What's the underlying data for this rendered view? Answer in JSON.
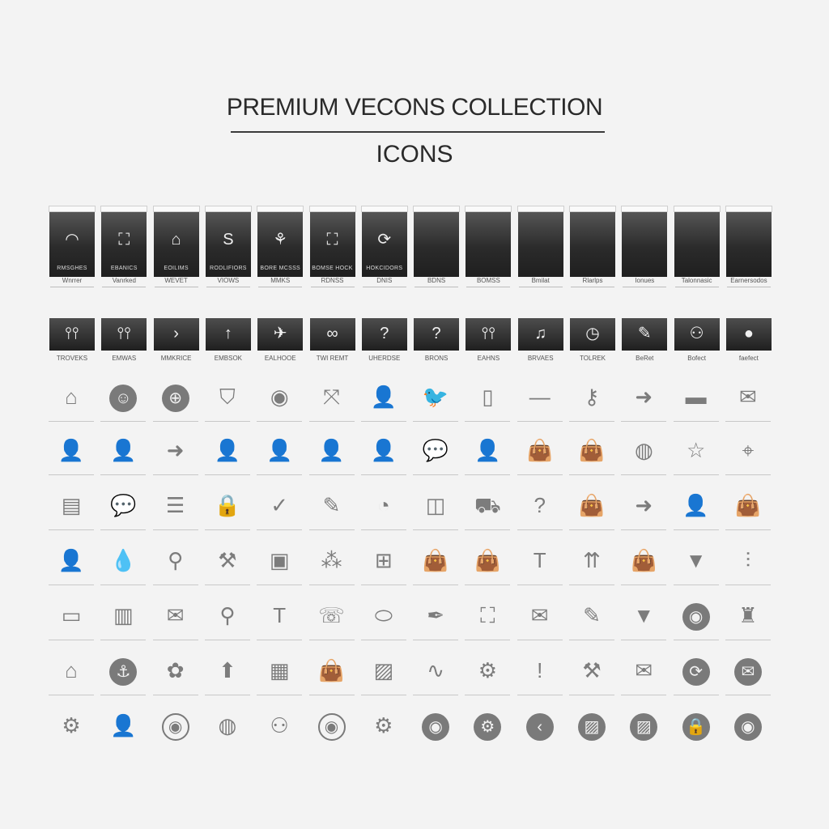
{
  "header": {
    "title": "PREMIUM VECONS COLLECTION",
    "subtitle": "ICONS"
  },
  "row1": [
    {
      "glyph": "wifi-icon",
      "char": "◠",
      "name": "RMSGHES",
      "caption": "Wnrrer"
    },
    {
      "glyph": "bag-icon",
      "char": "⛶",
      "name": "EBANICS",
      "caption": "Vanrked"
    },
    {
      "glyph": "bag-icon",
      "char": "⌂",
      "name": "EOILIMS",
      "caption": "WEVET"
    },
    {
      "glyph": "s-icon",
      "char": "S",
      "name": "RODLIFIORS",
      "caption": "VIOWS"
    },
    {
      "glyph": "leaf-icon",
      "char": "⚘",
      "name": "BORE MCSSS",
      "caption": "MMKS"
    },
    {
      "glyph": "bag-icon",
      "char": "⛶",
      "name": "BOMSE HOCK",
      "caption": "RDNSS"
    },
    {
      "glyph": "refresh-icon",
      "char": "⟳",
      "name": "HOKCIDORS",
      "caption": "DNIS"
    },
    {
      "glyph": "blank",
      "char": "",
      "name": "",
      "caption": "BDNS"
    },
    {
      "glyph": "blank",
      "char": "",
      "name": "",
      "caption": "BOMSS"
    },
    {
      "glyph": "blank",
      "char": "",
      "name": "",
      "caption": "Bmilat"
    },
    {
      "glyph": "blank",
      "char": "",
      "name": "",
      "caption": "Rlarlps"
    },
    {
      "glyph": "blank",
      "char": "",
      "name": "",
      "caption": "Ionues"
    },
    {
      "glyph": "blank",
      "char": "",
      "name": "",
      "caption": "Talonnasic"
    },
    {
      "glyph": "blank",
      "char": "",
      "name": "",
      "caption": "Earnersodos"
    }
  ],
  "row2": [
    {
      "glyph": "equalizer-icon",
      "char": "⫯⫯",
      "caption": "TROVEKS"
    },
    {
      "glyph": "equalizer-icon",
      "char": "⫯⫯",
      "caption": "EMWAS"
    },
    {
      "glyph": "chevron-right-icon",
      "char": "›",
      "caption": "MMKRICE"
    },
    {
      "glyph": "arrow-up-icon",
      "char": "↑",
      "caption": "EMBSOK"
    },
    {
      "glyph": "plane-icon",
      "char": "✈",
      "caption": "EALHOOE"
    },
    {
      "glyph": "infinity-icon",
      "char": "∞",
      "caption": "TWI REMT"
    },
    {
      "glyph": "question-icon",
      "char": "?",
      "caption": "UHERDSE"
    },
    {
      "glyph": "question-icon",
      "char": "?",
      "caption": "BRONS"
    },
    {
      "glyph": "equalizer-icon",
      "char": "⫯⫯",
      "caption": "EAHNS"
    },
    {
      "glyph": "music-icon",
      "char": "♫",
      "caption": "BRVAES"
    },
    {
      "glyph": "clock-icon",
      "char": "◷",
      "caption": "TOLREK"
    },
    {
      "glyph": "edit-icon",
      "char": "✎",
      "caption": "BeRet"
    },
    {
      "glyph": "users-icon",
      "char": "⚇",
      "caption": "Bofect"
    },
    {
      "glyph": "user-icon",
      "char": "●",
      "caption": "faefect"
    }
  ],
  "icon_rows": [
    [
      "home-icon",
      "add-user-icon",
      "plus-circle-icon",
      "shield-icon",
      "fingerprint-icon",
      "share-icon",
      "user-icon",
      "twitter-icon",
      "mobile-icon",
      "minus-icon",
      "key-icon",
      "arrow-right-icon",
      "rectangle-icon",
      "mail-icon"
    ],
    [
      "user-icon",
      "user-icon",
      "arrow-right-icon",
      "user-icon",
      "user-icon",
      "user-icon",
      "user-icon",
      "chat-icon",
      "user-icon",
      "bag-icon",
      "bag-icon",
      "globe-icon",
      "star-icon",
      "location-icon"
    ],
    [
      "card-icon",
      "chat-icon",
      "list-icon",
      "lock-user-icon",
      "check-icon",
      "pencil-icon",
      "compass-icon",
      "camera-icon",
      "truck-icon",
      "question-icon",
      "bag-icon",
      "arrow-right-icon",
      "user-icon",
      "bag-icon"
    ],
    [
      "user-icon",
      "drop-icon",
      "pin-icon",
      "tools-icon",
      "device-icon",
      "network-icon",
      "grid-icon",
      "bag-icon",
      "bag-icon",
      "hammer-icon",
      "arrows-up-icon",
      "bag-icon",
      "triangle-down-icon",
      "sliders-icon"
    ],
    [
      "tablet-icon",
      "chart-icon",
      "mail-icon",
      "pin-clip-icon",
      "hammer-icon",
      "phone-icon",
      "badge-icon",
      "pen-icon",
      "tag-icon",
      "mail-icon",
      "pencil-icon",
      "triangle-down-icon",
      "user-circle-icon",
      "hoodie-icon"
    ],
    [
      "home-icon",
      "anchor-icon",
      "gift-icon",
      "arrow-up-icon",
      "calendar-icon",
      "bag-icon",
      "image-icon",
      "wave-icon",
      "gear-icon",
      "bulb-icon",
      "tools-icon",
      "mail-icon",
      "refresh-icon",
      "mail-circle-icon"
    ],
    [
      "gear-icon",
      "user-icon",
      "user-circle-icon",
      "globe-icon",
      "users-icon",
      "user-circle-icon",
      "gear-icon",
      "user-circle-icon",
      "gear-icon",
      "chevron-left-icon",
      "image-icon",
      "image-icon",
      "lock-icon",
      "user-circle-icon"
    ]
  ],
  "icon_chars": {
    "home-icon": "⌂",
    "add-user-icon": "☺",
    "plus-circle-icon": "⊕",
    "shield-icon": "⛉",
    "fingerprint-icon": "◉",
    "share-icon": "⤧",
    "user-icon": "👤",
    "twitter-icon": "🐦",
    "mobile-icon": "▯",
    "minus-icon": "—",
    "key-icon": "⚷",
    "arrow-right-icon": "➜",
    "rectangle-icon": "▬",
    "mail-icon": "✉",
    "chat-icon": "💬",
    "bag-icon": "👜",
    "globe-icon": "◍",
    "star-icon": "☆",
    "location-icon": "⌖",
    "card-icon": "▤",
    "list-icon": "☰",
    "lock-user-icon": "🔒",
    "check-icon": "✓",
    "pencil-icon": "✎",
    "compass-icon": "◔",
    "camera-icon": "◫",
    "truck-icon": "⛟",
    "question-icon": "?",
    "drop-icon": "💧",
    "pin-icon": "⚲",
    "tools-icon": "⚒",
    "device-icon": "▣",
    "network-icon": "⁂",
    "grid-icon": "⊞",
    "hammer-icon": "T",
    "arrows-up-icon": "⇈",
    "triangle-down-icon": "▼",
    "sliders-icon": "⫶",
    "tablet-icon": "▭",
    "chart-icon": "▥",
    "pin-clip-icon": "⚲",
    "phone-icon": "☏",
    "badge-icon": "⬭",
    "pen-icon": "✒",
    "tag-icon": "⛶",
    "user-circle-icon": "◉",
    "hoodie-icon": "♜",
    "anchor-icon": "⚓",
    "gift-icon": "✿",
    "arrow-up-icon": "⬆",
    "calendar-icon": "▦",
    "image-icon": "▨",
    "wave-icon": "∿",
    "gear-icon": "⚙",
    "bulb-icon": "!",
    "refresh-icon": "⟳",
    "mail-circle-icon": "✉",
    "users-icon": "⚇",
    "chevron-left-icon": "‹",
    "lock-icon": "🔒"
  },
  "colors": {
    "background": "#f3f3f3",
    "tile_dark": "#2b2b2b",
    "icon_gray": "#7c7c7c"
  }
}
